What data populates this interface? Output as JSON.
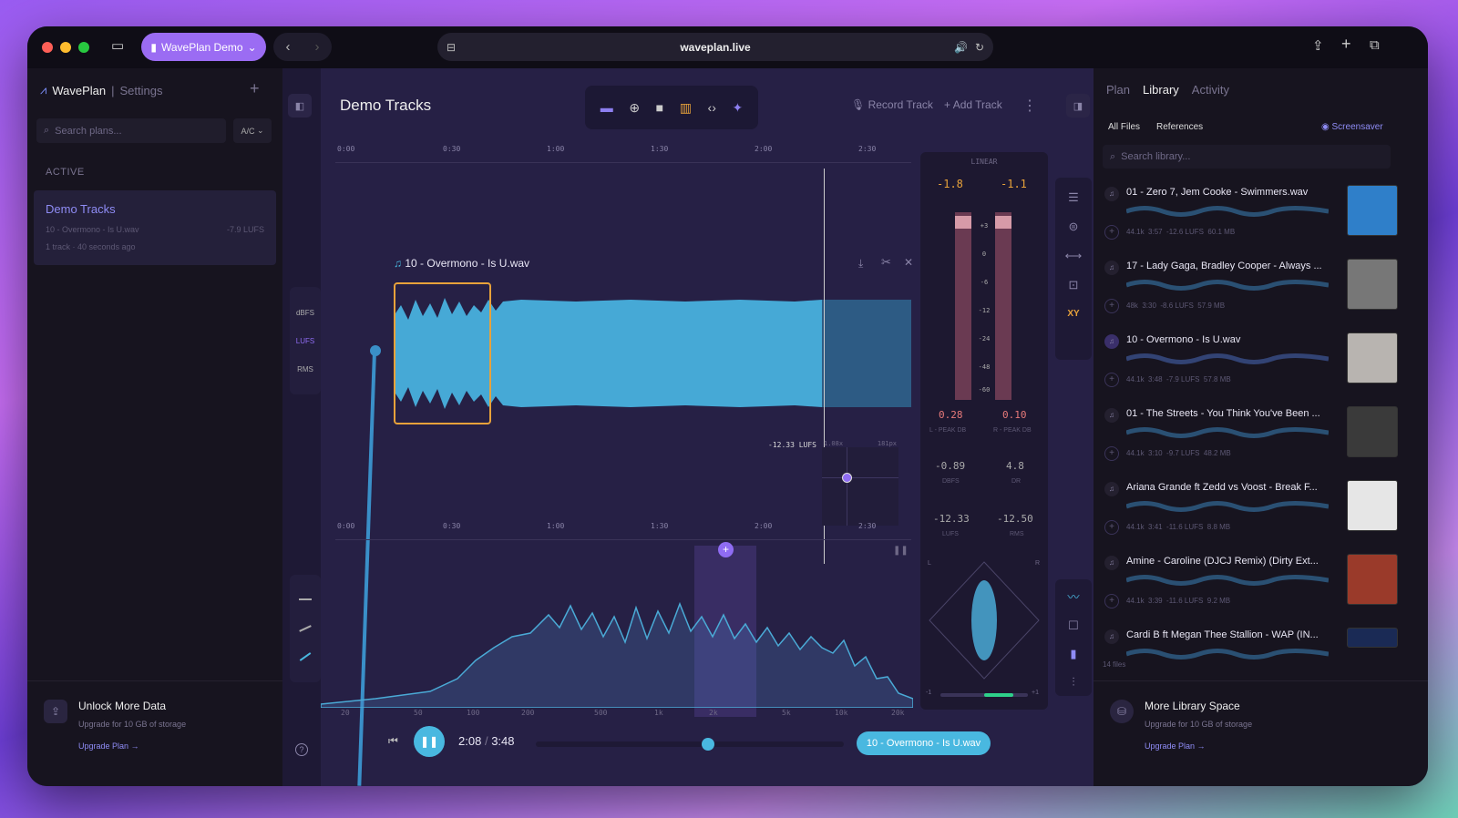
{
  "browser": {
    "tab_label": "WavePlan Demo",
    "url": "waveplan.live"
  },
  "left": {
    "brand": "WavePlan",
    "settings": "Settings",
    "search_placeholder": "Search plans...",
    "sort": "A/C",
    "section": "ACTIVE",
    "plan": {
      "title": "Demo Tracks",
      "track": "10 - Overmono - Is U.wav",
      "lufs": "-7.9 LUFS",
      "meta": "1 track · 40 seconds ago"
    },
    "promo": {
      "title": "Unlock More Data",
      "subtitle": "Upgrade for 10 GB of storage",
      "link": "Upgrade Plan →"
    }
  },
  "main": {
    "title": "Demo Tracks",
    "record": "Record Track",
    "add": "Add Track",
    "ruler": [
      "0:00",
      "0:30",
      "1:00",
      "1:30",
      "2:00",
      "2:30"
    ],
    "track_name": "10 - Overmono - Is U.wav",
    "track_lufs": "-12.33 LUFS",
    "modes": [
      "dBFS",
      "LUFS",
      "RMS"
    ],
    "mini_labels": [
      "1.08x",
      "181px"
    ],
    "freq_ticks": [
      "20",
      "50",
      "100",
      "200",
      "500",
      "1k",
      "2k",
      "5k",
      "10k",
      "20k"
    ],
    "time_current": "2:08",
    "time_sep": "/",
    "time_total": "3:48",
    "now_playing": "10 - Overmono - Is U.wav",
    "progress": 0.56
  },
  "meter": {
    "mode": "LINEAR",
    "l_peak": "-1.8",
    "r_peak": "-1.1",
    "scale": [
      "+3",
      "0",
      "-6",
      "-12",
      "-24",
      "-48",
      "-60"
    ],
    "l_val": "0.28",
    "r_val": "0.10",
    "l_label": "L - PEAK DB",
    "r_label": "R - PEAK DB",
    "dbfs": "-0.89",
    "dbfs_label": "DBFS",
    "dr": "4.8",
    "dr_label": "DR",
    "lufs": "-12.33",
    "lufs_label": "LUFS",
    "rms": "-12.50",
    "rms_label": "RMS",
    "corr_low": "-1",
    "corr_high": "+1",
    "xy": "XY",
    "l": "L",
    "r": "R"
  },
  "right": {
    "tabs": [
      "Plan",
      "Library",
      "Activity"
    ],
    "filters": [
      "All Files",
      "References"
    ],
    "screensaver": "Screensaver",
    "search_placeholder": "Search library...",
    "files": [
      {
        "name": "01 - Zero 7, Jem Cooke - Swimmers.wav",
        "meta": "44.1k  3:57  -12.6 LUFS  60.1 MB",
        "color": "#2f7fc9"
      },
      {
        "name": "17 - Lady Gaga, Bradley Cooper - Always ...",
        "meta": "48k  3:30  -8.6 LUFS  57.9 MB",
        "color": "#777"
      },
      {
        "name": "10 - Overmono - Is U.wav",
        "meta": "44.1k  3:48  -7.9 LUFS  57.8 MB",
        "color": "#b8b4b0"
      },
      {
        "name": "01 - The Streets - You Think You've Been ...",
        "meta": "44.1k  3:10  -9.7 LUFS  48.2 MB",
        "color": "#3a3a3a"
      },
      {
        "name": "Ariana Grande ft Zedd vs Voost - Break F...",
        "meta": "44.1k  3:41  -11.6 LUFS  8.8 MB",
        "color": "#e6e6e6"
      },
      {
        "name": "Amine - Caroline (DJCJ Remix) (Dirty Ext...",
        "meta": "44.1k  3:39  -11.6 LUFS  9.2 MB",
        "color": "#9a3a2a"
      },
      {
        "name": "Cardi B ft Megan Thee Stallion - WAP (IN...",
        "meta": "",
        "color": "#1a2a55"
      }
    ],
    "count": "14 files",
    "promo": {
      "title": "More Library Space",
      "subtitle": "Upgrade for 10 GB of storage",
      "link": "Upgrade Plan →"
    }
  }
}
